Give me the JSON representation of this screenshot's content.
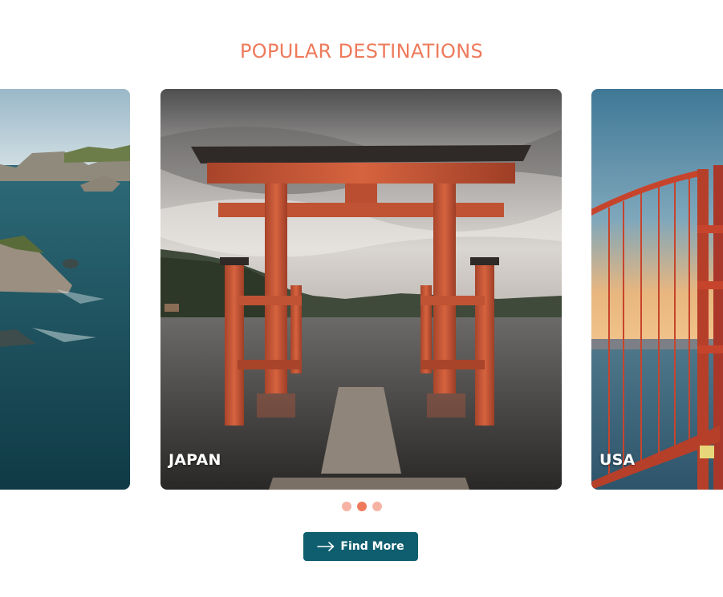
{
  "section": {
    "title": "POPULAR DESTINATIONS"
  },
  "carousel": {
    "slides": [
      {
        "label": ""
      },
      {
        "label": "JAPAN"
      },
      {
        "label": "USA"
      }
    ],
    "active_index": 1,
    "dot_count": 3
  },
  "cta": {
    "label": "Find More",
    "icon": "arrow-right-icon"
  },
  "colors": {
    "accent": "#ee7a5b",
    "accent_light": "#f6b3a3",
    "button": "#0e5e6f"
  }
}
